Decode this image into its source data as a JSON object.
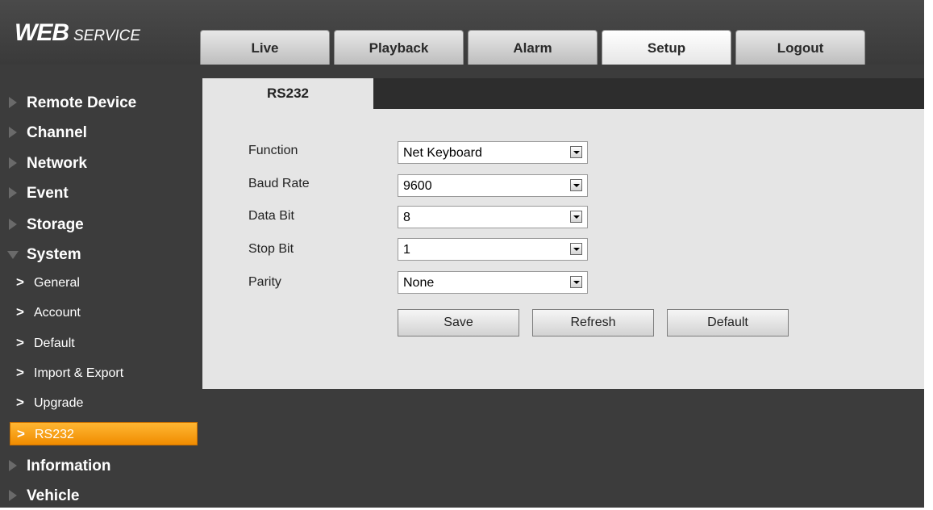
{
  "header": {
    "logo_main": "WEB",
    "logo_sub": "SERVICE",
    "tabs": [
      {
        "label": "Live"
      },
      {
        "label": "Playback"
      },
      {
        "label": "Alarm"
      },
      {
        "label": "Setup",
        "active": true
      },
      {
        "label": "Logout"
      }
    ]
  },
  "sidebar": {
    "items": [
      {
        "label": "Remote Device"
      },
      {
        "label": "Channel"
      },
      {
        "label": "Network"
      },
      {
        "label": "Event"
      },
      {
        "label": "Storage"
      },
      {
        "label": "System",
        "expanded": true
      },
      {
        "label": "Information"
      },
      {
        "label": "Vehicle"
      }
    ],
    "system_subitems": [
      {
        "label": "General"
      },
      {
        "label": "Account"
      },
      {
        "label": "Default"
      },
      {
        "label": "Import & Export"
      },
      {
        "label": "Upgrade"
      },
      {
        "label": "RS232",
        "active": true
      }
    ],
    "chevron": ">"
  },
  "content": {
    "tab_label": "RS232",
    "fields": [
      {
        "label": "Function",
        "value": "Net Keyboard"
      },
      {
        "label": "Baud Rate",
        "value": "9600"
      },
      {
        "label": "Data Bit",
        "value": "8"
      },
      {
        "label": "Stop Bit",
        "value": "1"
      },
      {
        "label": "Parity",
        "value": "None"
      }
    ],
    "buttons": {
      "save": "Save",
      "refresh": "Refresh",
      "default": "Default"
    }
  },
  "colors": {
    "background": "#3c3c3c",
    "panel": "#e5e5e5",
    "accent_active": "#f08c00"
  }
}
